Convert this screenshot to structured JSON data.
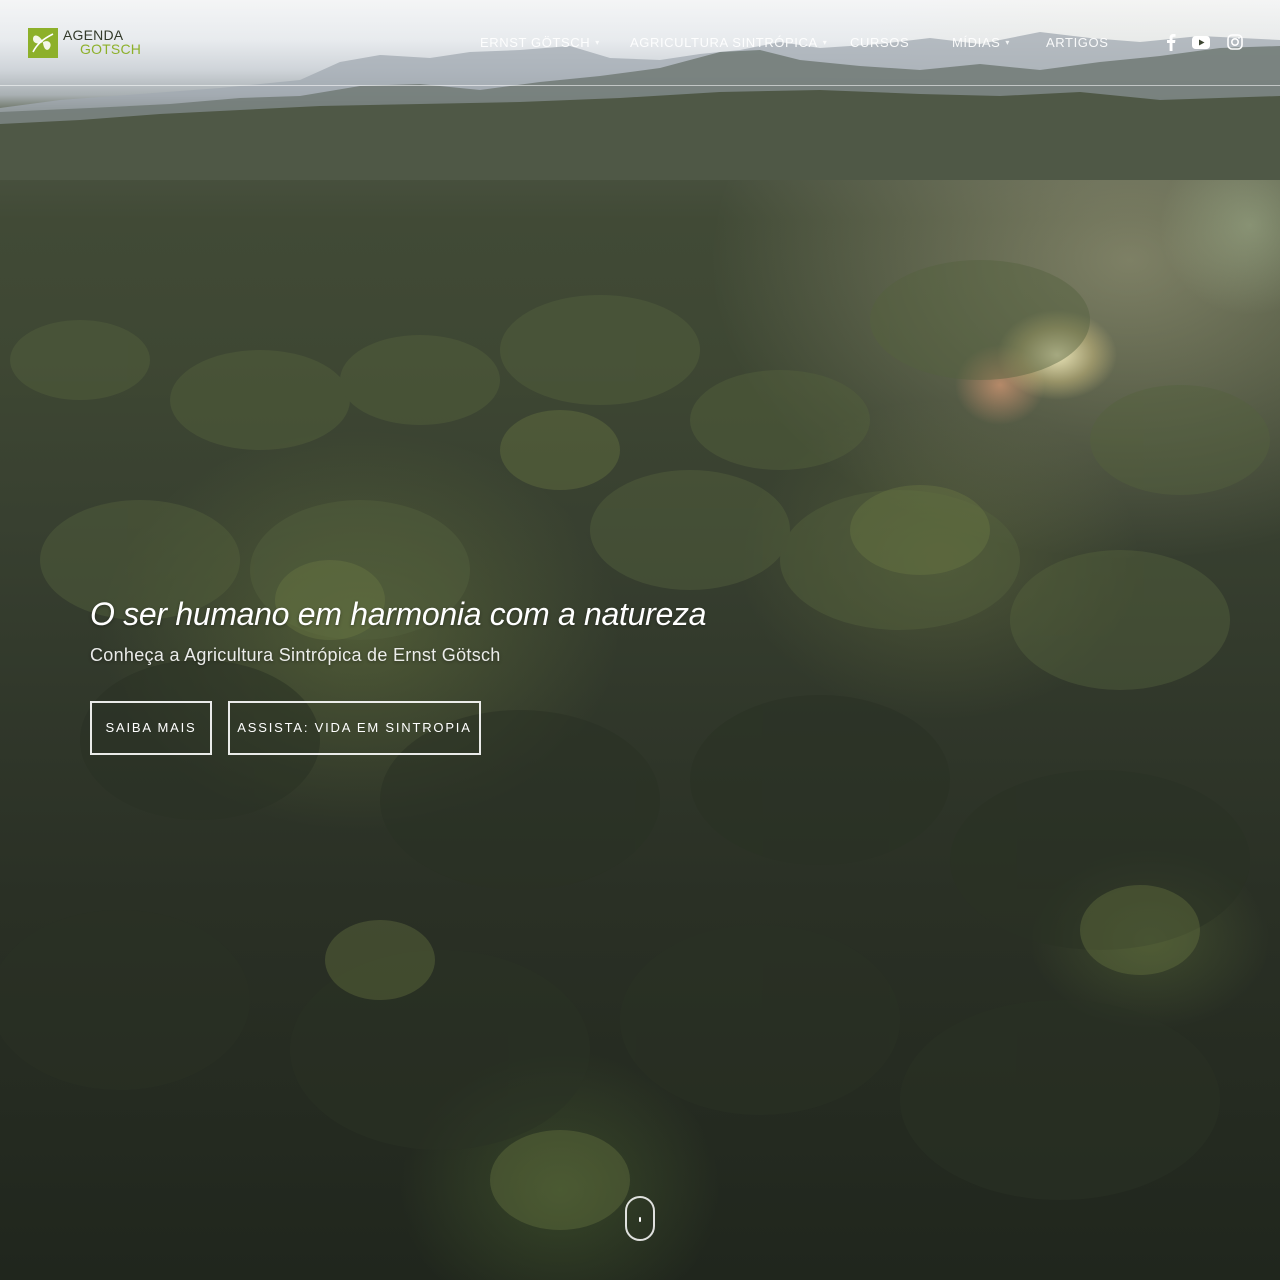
{
  "brand": {
    "line1": "AGENDA",
    "line2": "GOTSCH",
    "logo_icon": "leaf-butterfly-icon",
    "accent_color": "#8db02a"
  },
  "nav": {
    "items": [
      {
        "label": "ERNST GÖTSCH",
        "has_dropdown": true
      },
      {
        "label": "AGRICULTURA SINTRÓPICA",
        "has_dropdown": true
      },
      {
        "label": "CURSOS",
        "has_dropdown": false
      },
      {
        "label": "MÍDIAS",
        "has_dropdown": true
      },
      {
        "label": "ARTIGOS",
        "has_dropdown": false
      }
    ],
    "social": [
      "facebook-icon",
      "youtube-icon",
      "instagram-icon"
    ]
  },
  "hero": {
    "title": "O ser humano em harmonia com a natureza",
    "subtitle": "Conheça a Agricultura Sintrópica de Ernst Götsch",
    "buttons": [
      {
        "label": "SAIBA MAIS"
      },
      {
        "label": "ASSISTA: VIDA EM SINTROPIA"
      }
    ],
    "scroll_icon": "mouse-scroll-icon"
  }
}
